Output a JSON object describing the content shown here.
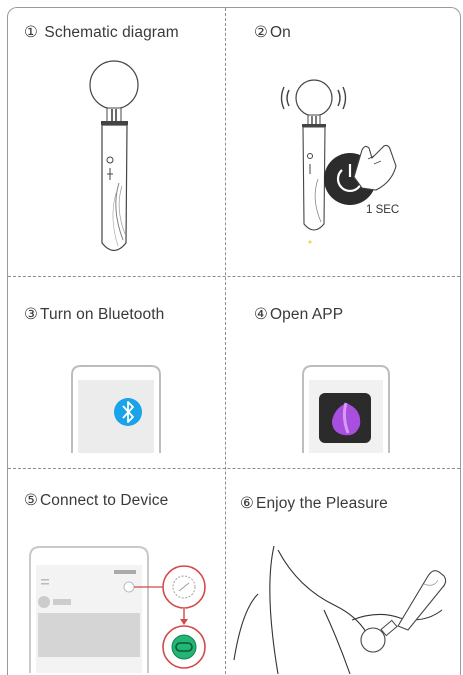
{
  "cells": [
    {
      "num": "①",
      "title": "Schematic diagram"
    },
    {
      "num": "②",
      "title": "On"
    },
    {
      "num": "③",
      "title": "Turn on Bluetooth"
    },
    {
      "num": "④",
      "title": "Open APP"
    },
    {
      "num": "⑤",
      "title": "Connect to Device"
    },
    {
      "num": "⑥",
      "title": "Enjoy the Pleasure"
    }
  ],
  "press_duration": "1 SEC",
  "colors": {
    "border": "#9a9a9a",
    "bluetooth": "#1aa3e8",
    "app_icon_bg": "#2b2b2b",
    "app_logo": "#a84fe0",
    "connect_accent": "#d24a4a",
    "connect_button": "#22b573"
  }
}
